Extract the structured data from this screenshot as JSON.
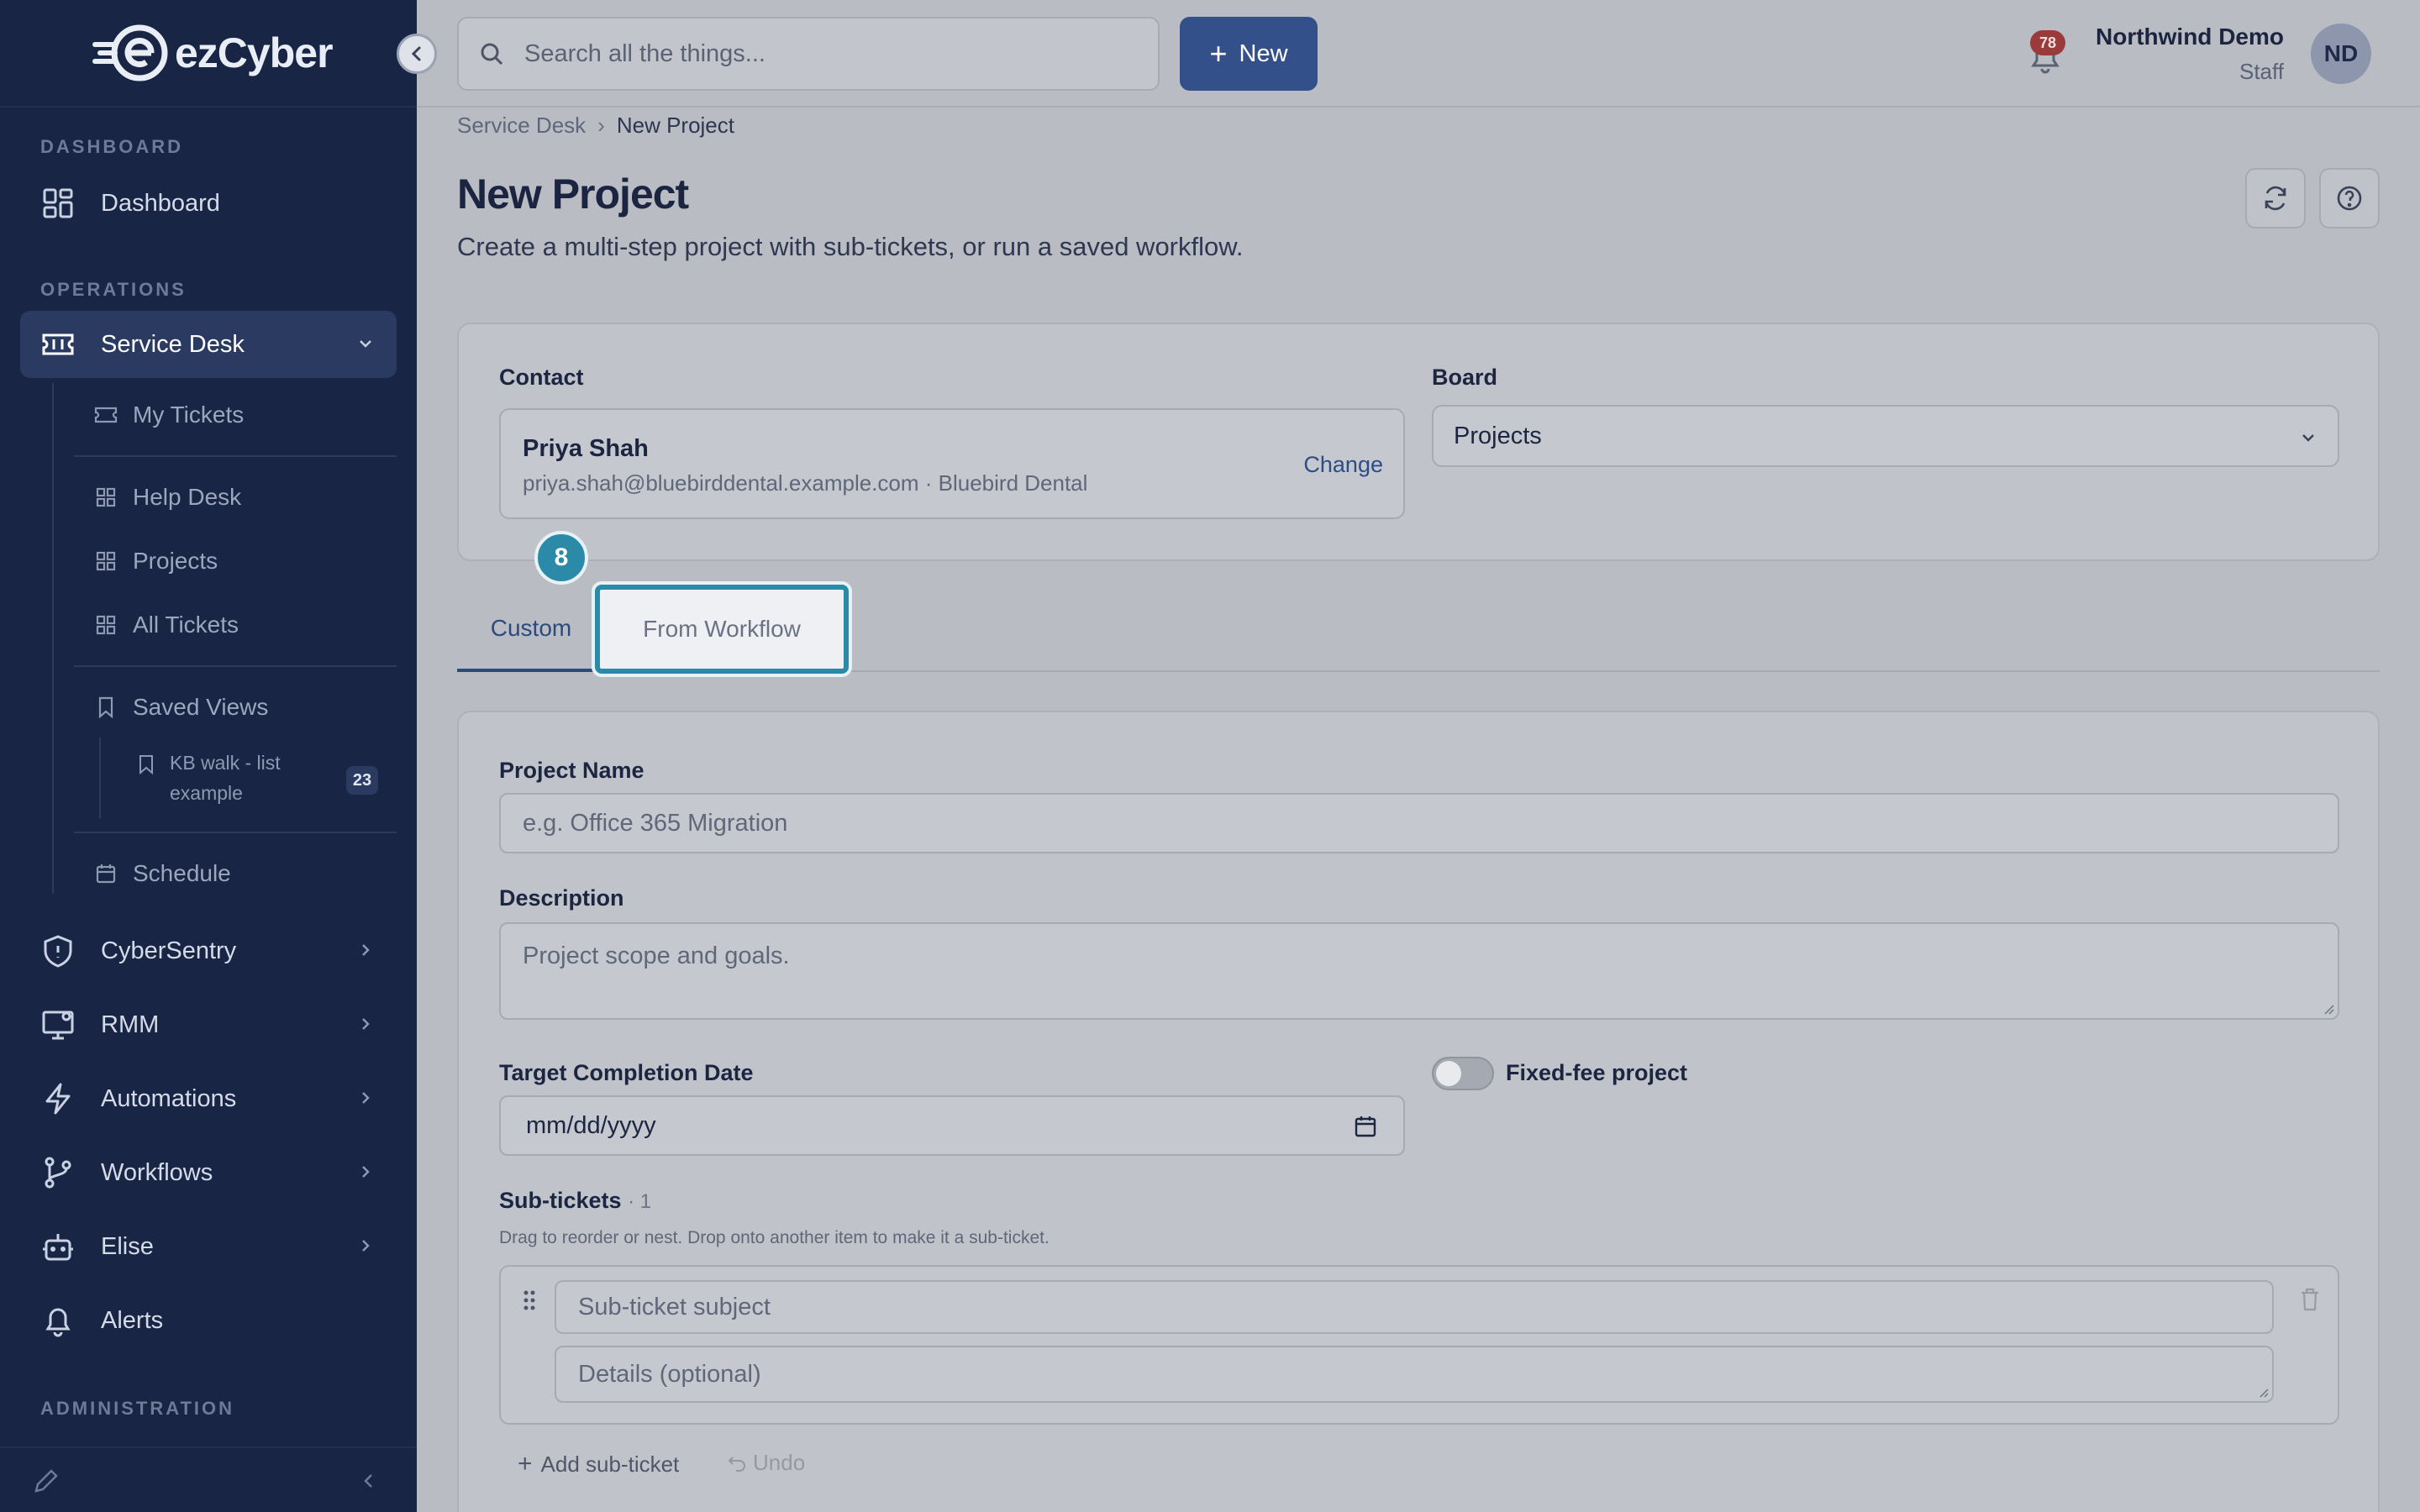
{
  "brand": {
    "name": "ezCyber"
  },
  "sidebar": {
    "sections": {
      "dashboard": "DASHBOARD",
      "operations": "OPERATIONS",
      "administration": "ADMINISTRATION"
    },
    "items": [
      {
        "label": "Dashboard",
        "icon": "grid-icon"
      },
      {
        "label": "Service Desk",
        "icon": "ticket-icon",
        "active": true,
        "expanded": true
      },
      {
        "label": "CyberSentry",
        "icon": "shield-icon"
      },
      {
        "label": "RMM",
        "icon": "monitor-icon"
      },
      {
        "label": "Automations",
        "icon": "bolt-icon"
      },
      {
        "label": "Workflows",
        "icon": "branch-icon"
      },
      {
        "label": "Elise",
        "icon": "bot-icon"
      },
      {
        "label": "Alerts",
        "icon": "bell-icon"
      }
    ],
    "service_desk_children": [
      {
        "label": "My Tickets",
        "icon": "ticket-icon"
      },
      {
        "label": "Help Desk",
        "icon": "grid-icon"
      },
      {
        "label": "Projects",
        "icon": "grid-icon"
      },
      {
        "label": "All Tickets",
        "icon": "grid-icon"
      },
      {
        "label": "Saved Views",
        "icon": "bookmark-icon"
      },
      {
        "label": "Schedule",
        "icon": "calendar-icon"
      }
    ],
    "saved_view": {
      "label": "KB walk - list example",
      "count": "23"
    }
  },
  "topbar": {
    "search_placeholder": "Search all the things...",
    "new_label": "New",
    "notification_count": "78",
    "user_name": "Northwind Demo",
    "user_role": "Staff",
    "avatar_initials": "ND"
  },
  "breadcrumb": {
    "parent": "Service Desk",
    "current": "New Project"
  },
  "page": {
    "title": "New Project",
    "subtitle": "Create a multi-step project with sub-tickets, or run a saved workflow."
  },
  "contact": {
    "label": "Contact",
    "name": "Priya Shah",
    "meta": "priya.shah@bluebirddental.example.com · Bluebird Dental",
    "change_label": "Change"
  },
  "board": {
    "label": "Board",
    "value": "Projects"
  },
  "step_badge": "8",
  "tabs": {
    "custom": "Custom",
    "workflow": "From Workflow"
  },
  "form": {
    "project_name_label": "Project Name",
    "project_name_placeholder": "e.g. Office 365 Migration",
    "description_label": "Description",
    "description_placeholder": "Project scope and goals.",
    "target_date_label": "Target Completion Date",
    "target_date_placeholder": "mm/dd/yyyy",
    "fixed_fee_label": "Fixed-fee project",
    "subtickets_label": "Sub-tickets",
    "subtickets_count": "· 1",
    "subtickets_help": "Drag to reorder or nest. Drop onto another item to make it a sub-ticket.",
    "subticket_subject_placeholder": "Sub-ticket subject",
    "subticket_details_placeholder": "Details (optional)",
    "add_subticket_label": "Add sub-ticket",
    "undo_label": "Undo"
  },
  "colors": {
    "sidebar_bg": "#182544",
    "primary": "#33508a",
    "highlight": "#2a8aa8",
    "badge_red": "#9a3a3a"
  }
}
